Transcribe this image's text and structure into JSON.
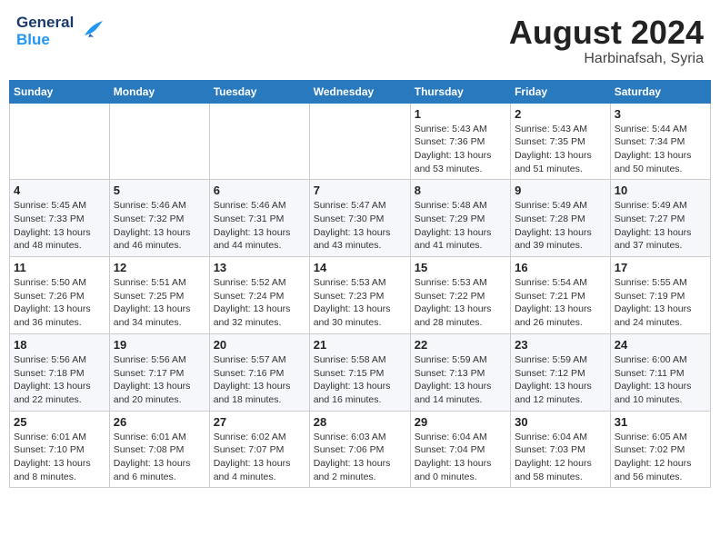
{
  "header": {
    "logo_line1": "General",
    "logo_line2": "Blue",
    "month_title": "August 2024",
    "location": "Harbinafsah, Syria"
  },
  "weekdays": [
    "Sunday",
    "Monday",
    "Tuesday",
    "Wednesday",
    "Thursday",
    "Friday",
    "Saturday"
  ],
  "weeks": [
    [
      {
        "day": "",
        "sunrise": "",
        "sunset": "",
        "daylight": ""
      },
      {
        "day": "",
        "sunrise": "",
        "sunset": "",
        "daylight": ""
      },
      {
        "day": "",
        "sunrise": "",
        "sunset": "",
        "daylight": ""
      },
      {
        "day": "",
        "sunrise": "",
        "sunset": "",
        "daylight": ""
      },
      {
        "day": "1",
        "sunrise": "Sunrise: 5:43 AM",
        "sunset": "Sunset: 7:36 PM",
        "daylight": "Daylight: 13 hours and 53 minutes."
      },
      {
        "day": "2",
        "sunrise": "Sunrise: 5:43 AM",
        "sunset": "Sunset: 7:35 PM",
        "daylight": "Daylight: 13 hours and 51 minutes."
      },
      {
        "day": "3",
        "sunrise": "Sunrise: 5:44 AM",
        "sunset": "Sunset: 7:34 PM",
        "daylight": "Daylight: 13 hours and 50 minutes."
      }
    ],
    [
      {
        "day": "4",
        "sunrise": "Sunrise: 5:45 AM",
        "sunset": "Sunset: 7:33 PM",
        "daylight": "Daylight: 13 hours and 48 minutes."
      },
      {
        "day": "5",
        "sunrise": "Sunrise: 5:46 AM",
        "sunset": "Sunset: 7:32 PM",
        "daylight": "Daylight: 13 hours and 46 minutes."
      },
      {
        "day": "6",
        "sunrise": "Sunrise: 5:46 AM",
        "sunset": "Sunset: 7:31 PM",
        "daylight": "Daylight: 13 hours and 44 minutes."
      },
      {
        "day": "7",
        "sunrise": "Sunrise: 5:47 AM",
        "sunset": "Sunset: 7:30 PM",
        "daylight": "Daylight: 13 hours and 43 minutes."
      },
      {
        "day": "8",
        "sunrise": "Sunrise: 5:48 AM",
        "sunset": "Sunset: 7:29 PM",
        "daylight": "Daylight: 13 hours and 41 minutes."
      },
      {
        "day": "9",
        "sunrise": "Sunrise: 5:49 AM",
        "sunset": "Sunset: 7:28 PM",
        "daylight": "Daylight: 13 hours and 39 minutes."
      },
      {
        "day": "10",
        "sunrise": "Sunrise: 5:49 AM",
        "sunset": "Sunset: 7:27 PM",
        "daylight": "Daylight: 13 hours and 37 minutes."
      }
    ],
    [
      {
        "day": "11",
        "sunrise": "Sunrise: 5:50 AM",
        "sunset": "Sunset: 7:26 PM",
        "daylight": "Daylight: 13 hours and 36 minutes."
      },
      {
        "day": "12",
        "sunrise": "Sunrise: 5:51 AM",
        "sunset": "Sunset: 7:25 PM",
        "daylight": "Daylight: 13 hours and 34 minutes."
      },
      {
        "day": "13",
        "sunrise": "Sunrise: 5:52 AM",
        "sunset": "Sunset: 7:24 PM",
        "daylight": "Daylight: 13 hours and 32 minutes."
      },
      {
        "day": "14",
        "sunrise": "Sunrise: 5:53 AM",
        "sunset": "Sunset: 7:23 PM",
        "daylight": "Daylight: 13 hours and 30 minutes."
      },
      {
        "day": "15",
        "sunrise": "Sunrise: 5:53 AM",
        "sunset": "Sunset: 7:22 PM",
        "daylight": "Daylight: 13 hours and 28 minutes."
      },
      {
        "day": "16",
        "sunrise": "Sunrise: 5:54 AM",
        "sunset": "Sunset: 7:21 PM",
        "daylight": "Daylight: 13 hours and 26 minutes."
      },
      {
        "day": "17",
        "sunrise": "Sunrise: 5:55 AM",
        "sunset": "Sunset: 7:19 PM",
        "daylight": "Daylight: 13 hours and 24 minutes."
      }
    ],
    [
      {
        "day": "18",
        "sunrise": "Sunrise: 5:56 AM",
        "sunset": "Sunset: 7:18 PM",
        "daylight": "Daylight: 13 hours and 22 minutes."
      },
      {
        "day": "19",
        "sunrise": "Sunrise: 5:56 AM",
        "sunset": "Sunset: 7:17 PM",
        "daylight": "Daylight: 13 hours and 20 minutes."
      },
      {
        "day": "20",
        "sunrise": "Sunrise: 5:57 AM",
        "sunset": "Sunset: 7:16 PM",
        "daylight": "Daylight: 13 hours and 18 minutes."
      },
      {
        "day": "21",
        "sunrise": "Sunrise: 5:58 AM",
        "sunset": "Sunset: 7:15 PM",
        "daylight": "Daylight: 13 hours and 16 minutes."
      },
      {
        "day": "22",
        "sunrise": "Sunrise: 5:59 AM",
        "sunset": "Sunset: 7:13 PM",
        "daylight": "Daylight: 13 hours and 14 minutes."
      },
      {
        "day": "23",
        "sunrise": "Sunrise: 5:59 AM",
        "sunset": "Sunset: 7:12 PM",
        "daylight": "Daylight: 13 hours and 12 minutes."
      },
      {
        "day": "24",
        "sunrise": "Sunrise: 6:00 AM",
        "sunset": "Sunset: 7:11 PM",
        "daylight": "Daylight: 13 hours and 10 minutes."
      }
    ],
    [
      {
        "day": "25",
        "sunrise": "Sunrise: 6:01 AM",
        "sunset": "Sunset: 7:10 PM",
        "daylight": "Daylight: 13 hours and 8 minutes."
      },
      {
        "day": "26",
        "sunrise": "Sunrise: 6:01 AM",
        "sunset": "Sunset: 7:08 PM",
        "daylight": "Daylight: 13 hours and 6 minutes."
      },
      {
        "day": "27",
        "sunrise": "Sunrise: 6:02 AM",
        "sunset": "Sunset: 7:07 PM",
        "daylight": "Daylight: 13 hours and 4 minutes."
      },
      {
        "day": "28",
        "sunrise": "Sunrise: 6:03 AM",
        "sunset": "Sunset: 7:06 PM",
        "daylight": "Daylight: 13 hours and 2 minutes."
      },
      {
        "day": "29",
        "sunrise": "Sunrise: 6:04 AM",
        "sunset": "Sunset: 7:04 PM",
        "daylight": "Daylight: 13 hours and 0 minutes."
      },
      {
        "day": "30",
        "sunrise": "Sunrise: 6:04 AM",
        "sunset": "Sunset: 7:03 PM",
        "daylight": "Daylight: 12 hours and 58 minutes."
      },
      {
        "day": "31",
        "sunrise": "Sunrise: 6:05 AM",
        "sunset": "Sunset: 7:02 PM",
        "daylight": "Daylight: 12 hours and 56 minutes."
      }
    ]
  ]
}
